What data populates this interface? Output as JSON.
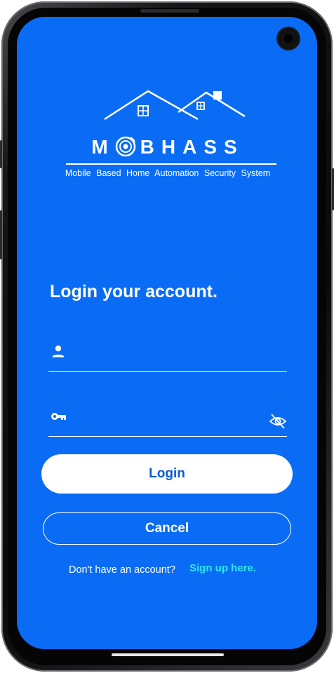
{
  "app": {
    "logo_word_before_o": "M",
    "logo_word_after_o": "BHASS",
    "logo_tagline": "Mobile Based Home Automation Security System"
  },
  "login": {
    "title": "Login your account.",
    "username": {
      "value": "",
      "placeholder": "",
      "icon": "person-icon"
    },
    "password": {
      "value": "",
      "placeholder": "",
      "icon": "key-icon",
      "toggle_icon": "eye-off-icon"
    },
    "login_label": "Login",
    "cancel_label": "Cancel",
    "signup_prompt": "Don't have an account?",
    "signup_link": "Sign up here."
  },
  "colors": {
    "background": "#0a6cf5",
    "accent_link": "#2ee6f0",
    "button_text": "#0a5ad6",
    "foreground": "#ffffff"
  }
}
